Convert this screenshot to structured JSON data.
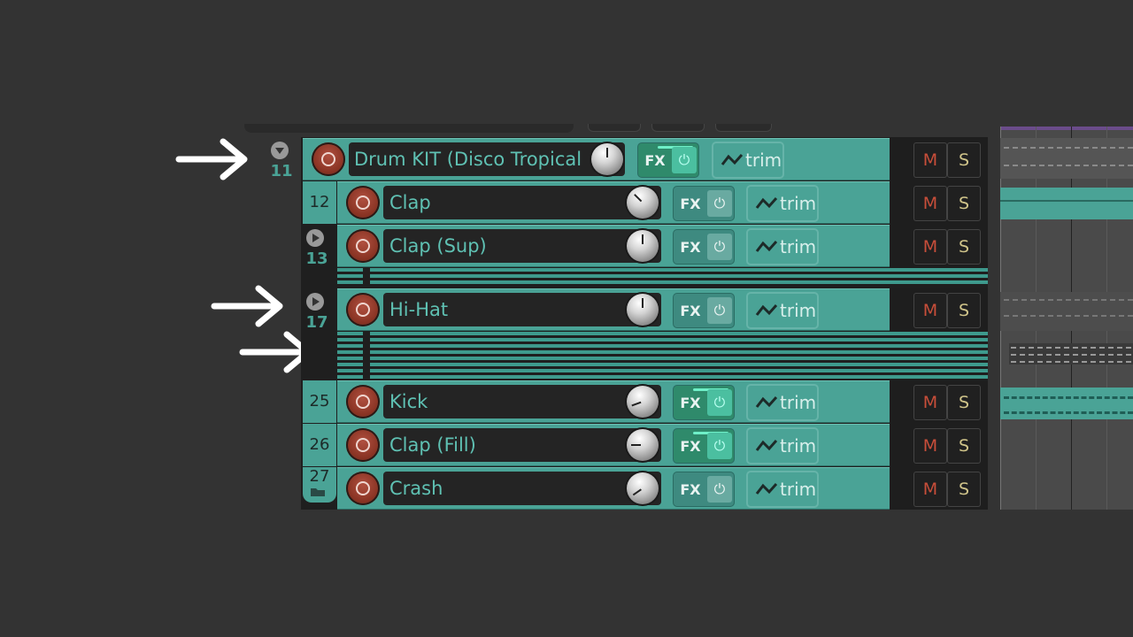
{
  "colors": {
    "track": "#4aa396",
    "track_text": "#5fc1b3",
    "record": "#8a3424",
    "mute": "#c84e3a",
    "solo": "#d0c48a",
    "fx_active": "#6ff0c8"
  },
  "arrows": [
    "arrow-icon",
    "arrow-icon",
    "arrow-icon"
  ],
  "tracks": [
    {
      "number": "11",
      "name": "Drum KIT (Disco Tropical",
      "folder": "collapse-folder-icon",
      "fx": "FX",
      "fx_active": true,
      "power": "⏻",
      "trim": "trim",
      "mute": "M",
      "solo": "S"
    },
    {
      "number": "12",
      "name": "Clap",
      "fx": "FX",
      "fx_active": false,
      "power": "⏻",
      "trim": "trim",
      "mute": "M",
      "solo": "S"
    },
    {
      "number": "13",
      "name": "Clap (Sup)",
      "folder": "expand-folder-icon",
      "fx": "FX",
      "fx_active": false,
      "power": "⏻",
      "trim": "trim",
      "mute": "M",
      "solo": "S"
    },
    {
      "number": "17",
      "name": "Hi-Hat",
      "folder": "expand-folder-icon",
      "fx": "FX",
      "fx_active": false,
      "power": "⏻",
      "trim": "trim",
      "mute": "M",
      "solo": "S"
    },
    {
      "number": "25",
      "name": "Kick",
      "fx": "FX",
      "fx_active": true,
      "power": "⏻",
      "trim": "trim",
      "mute": "M",
      "solo": "S"
    },
    {
      "number": "26",
      "name": "Clap (Fill)",
      "fx": "FX",
      "fx_active": true,
      "power": "⏻",
      "trim": "trim",
      "mute": "M",
      "solo": "S"
    },
    {
      "number": "27",
      "name": "Crash",
      "folder": "folder-icon",
      "fx": "FX",
      "fx_active": false,
      "power": "⏻",
      "trim": "trim",
      "mute": "M",
      "solo": "S"
    }
  ]
}
